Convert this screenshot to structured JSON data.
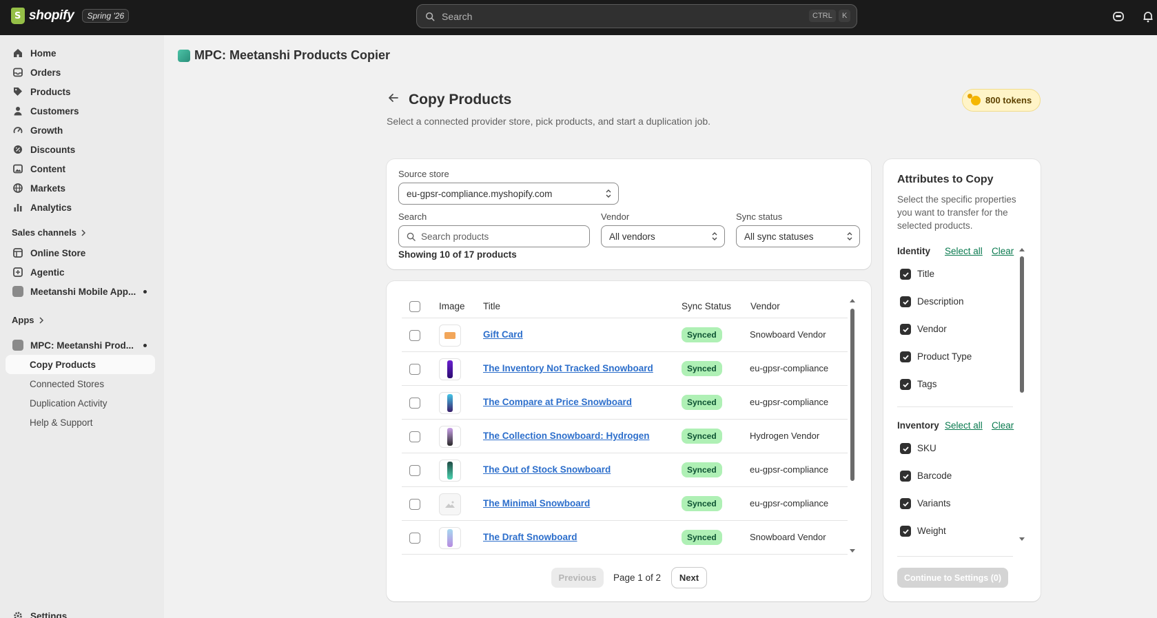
{
  "topbar": {
    "brand": "shopify",
    "edition_badge": "Spring '26",
    "search_placeholder": "Search",
    "shortcut_ctrl": "CTRL",
    "shortcut_key": "K"
  },
  "sidebar": {
    "items": [
      {
        "label": "Home",
        "icon": "home-icon"
      },
      {
        "label": "Orders",
        "icon": "inbox-icon"
      },
      {
        "label": "Products",
        "icon": "tag-icon"
      },
      {
        "label": "Customers",
        "icon": "person-icon"
      },
      {
        "label": "Growth",
        "icon": "gauge-icon"
      },
      {
        "label": "Discounts",
        "icon": "discount-icon"
      },
      {
        "label": "Content",
        "icon": "image-icon"
      },
      {
        "label": "Markets",
        "icon": "globe-icon"
      },
      {
        "label": "Analytics",
        "icon": "bar-chart-icon"
      }
    ],
    "sales_channels_label": "Sales channels",
    "channels": [
      {
        "label": "Online Store",
        "icon": "store-icon"
      },
      {
        "label": "Agentic",
        "icon": "agentic-icon"
      },
      {
        "label": "Meetanshi Mobile App...",
        "icon": "app-icon"
      }
    ],
    "apps_label": "Apps",
    "app_name": "MPC: Meetanshi Prod...",
    "app_subitems": [
      "Copy Products",
      "Connected Stores",
      "Duplication Activity",
      "Help & Support"
    ],
    "settings_label": "Settings"
  },
  "app_header": {
    "title": "MPC: Meetanshi Products Copier"
  },
  "page": {
    "title": "Copy Products",
    "subtitle": "Select a connected provider store, pick products, and start a duplication job.",
    "tokens": "800 tokens"
  },
  "filters": {
    "source_store_label": "Source store",
    "source_store_value": "eu-gpsr-compliance.myshopify.com",
    "search_label": "Search",
    "search_placeholder": "Search products",
    "vendor_label": "Vendor",
    "vendor_value": "All vendors",
    "sync_label": "Sync status",
    "sync_value": "All sync statuses",
    "showing": "Showing 10 of 17 products"
  },
  "table": {
    "headers": {
      "image": "Image",
      "title": "Title",
      "sync": "Sync Status",
      "vendor": "Vendor"
    },
    "rows": [
      {
        "title": "Gift Card",
        "status": "Synced",
        "vendor": "Snowboard Vendor"
      },
      {
        "title": "The Inventory Not Tracked Snowboard",
        "status": "Synced",
        "vendor": "eu-gpsr-compliance"
      },
      {
        "title": "The Compare at Price Snowboard",
        "status": "Synced",
        "vendor": "eu-gpsr-compliance"
      },
      {
        "title": "The Collection Snowboard: Hydrogen",
        "status": "Synced",
        "vendor": "Hydrogen Vendor"
      },
      {
        "title": "The Out of Stock Snowboard",
        "status": "Synced",
        "vendor": "eu-gpsr-compliance"
      },
      {
        "title": "The Minimal Snowboard",
        "status": "Synced",
        "vendor": "eu-gpsr-compliance"
      },
      {
        "title": "The Draft Snowboard",
        "status": "Synced",
        "vendor": "Snowboard Vendor"
      }
    ]
  },
  "pagination": {
    "previous": "Previous",
    "page_text": "Page 1 of 2",
    "next": "Next"
  },
  "attributes": {
    "title": "Attributes to Copy",
    "description": "Select the specific properties you want to transfer for the selected products.",
    "select_all": "Select all",
    "clear": "Clear",
    "groups": [
      {
        "name": "Identity",
        "items": [
          "Title",
          "Description",
          "Vendor",
          "Product Type",
          "Tags"
        ]
      },
      {
        "name": "Inventory",
        "items": [
          "SKU",
          "Barcode",
          "Variants",
          "Weight"
        ]
      }
    ],
    "continue_label": "Continue to Settings (0)"
  },
  "colors": {
    "accent_green": "#0a7a4f",
    "synced_bg": "#aff0b5",
    "link_blue": "#2c6ecb"
  }
}
